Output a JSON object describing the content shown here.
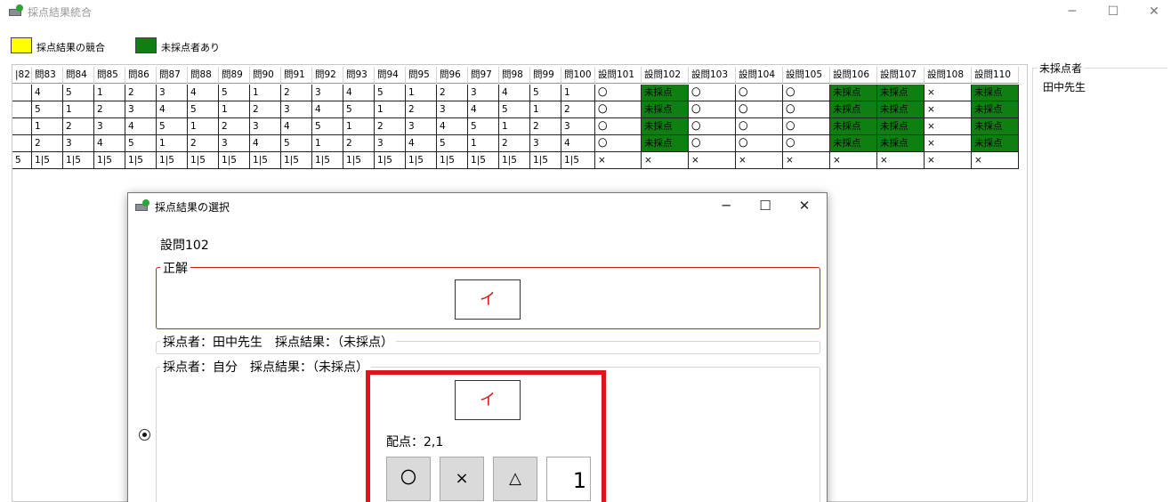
{
  "window": {
    "title": "採点結果統合",
    "controls": {
      "minimize": "─",
      "maximize": "☐",
      "close": "✕"
    }
  },
  "legend": [
    {
      "label": "採点結果の競合",
      "color": "#ffff00"
    },
    {
      "label": "未採点者あり",
      "color": "#0f7f12"
    }
  ],
  "grid": {
    "headers": [
      "|82",
      "問83",
      "問84",
      "問85",
      "問86",
      "問87",
      "問88",
      "問89",
      "問90",
      "問91",
      "問92",
      "問93",
      "問94",
      "問95",
      "問96",
      "問97",
      "問98",
      "問99",
      "問100",
      "設問101",
      "設問102",
      "設問103",
      "設問104",
      "設問105",
      "設問106",
      "設問107",
      "設問108",
      "設問110"
    ],
    "rows": [
      [
        "",
        "4",
        "5",
        "1",
        "2",
        "3",
        "4",
        "5",
        "1",
        "2",
        "3",
        "4",
        "5",
        "1",
        "2",
        "3",
        "4",
        "5",
        "1",
        "〇",
        "未採点",
        "〇",
        "〇",
        "〇",
        "未採点",
        "未採点",
        "×",
        "未採点"
      ],
      [
        "",
        "5",
        "1",
        "2",
        "3",
        "4",
        "5",
        "1",
        "2",
        "3",
        "4",
        "5",
        "1",
        "2",
        "3",
        "4",
        "5",
        "1",
        "2",
        "〇",
        "未採点",
        "〇",
        "〇",
        "〇",
        "未採点",
        "未採点",
        "×",
        "未採点"
      ],
      [
        "",
        "1",
        "2",
        "3",
        "4",
        "5",
        "1",
        "2",
        "3",
        "4",
        "5",
        "1",
        "2",
        "3",
        "4",
        "5",
        "1",
        "2",
        "3",
        "〇",
        "未採点",
        "〇",
        "〇",
        "〇",
        "未採点",
        "未採点",
        "×",
        "未採点"
      ],
      [
        "",
        "2",
        "3",
        "4",
        "5",
        "1",
        "2",
        "3",
        "4",
        "5",
        "1",
        "2",
        "3",
        "4",
        "5",
        "1",
        "2",
        "3",
        "4",
        "〇",
        "未採点",
        "〇",
        "〇",
        "〇",
        "未採点",
        "未採点",
        "×",
        "未採点"
      ],
      [
        "5",
        "1|5",
        "1|5",
        "1|5",
        "1|5",
        "1|5",
        "1|5",
        "1|5",
        "1|5",
        "1|5",
        "1|5",
        "1|5",
        "1|5",
        "1|5",
        "1|5",
        "1|5",
        "1|5",
        "1|5",
        "1|5",
        "×",
        "×",
        "×",
        "×",
        "×",
        "×",
        "×",
        "×",
        "×"
      ]
    ]
  },
  "side_panel": {
    "title": "未採点者",
    "items": [
      "田中先生"
    ]
  },
  "dialog": {
    "title": "採点結果の選択",
    "controls": {
      "minimize": "─",
      "maximize": "☐",
      "close": "✕"
    },
    "question": "設問102",
    "correct_section": {
      "label": "正解",
      "answer": "イ"
    },
    "grader1_section": {
      "label": "採点者：田中先生　採点結果：（未採点）"
    },
    "grader2_section": {
      "label": "採点者：自分　採点結果：（未採点）",
      "answer": "イ",
      "score_label": "配点：2,1",
      "buttons": {
        "correct": "〇",
        "wrong": "×",
        "partial": "△"
      },
      "score_value": "1",
      "selected": true
    }
  },
  "colors": {
    "unscored_green": "#0f7f12",
    "conflict_yellow": "#ffff00",
    "highlight_red": "#e0141c",
    "correct_border": "#c42222"
  }
}
